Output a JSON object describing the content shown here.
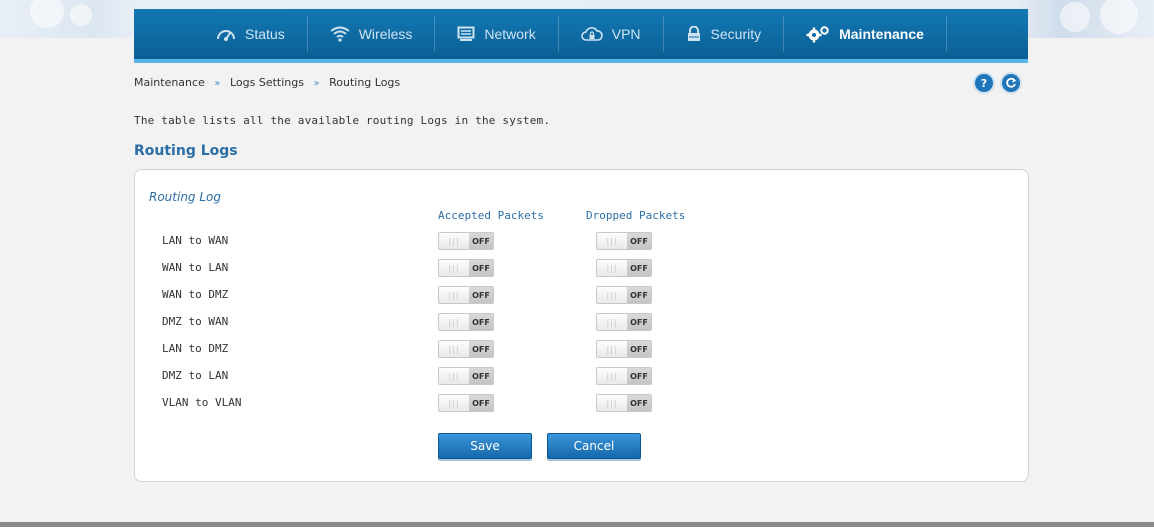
{
  "nav": {
    "items": [
      {
        "label": "Status",
        "icon": "dashboard-icon",
        "active": false
      },
      {
        "label": "Wireless",
        "icon": "wifi-icon",
        "active": false
      },
      {
        "label": "Network",
        "icon": "monitor-icon",
        "active": false
      },
      {
        "label": "VPN",
        "icon": "cloud-lock-icon",
        "active": false
      },
      {
        "label": "Security",
        "icon": "lock-icon",
        "active": false
      },
      {
        "label": "Maintenance",
        "icon": "gears-icon",
        "active": true
      }
    ],
    "colors": {
      "bar": "#0b6aa5",
      "accent": "#58b4e8"
    }
  },
  "breadcrumb": {
    "items": [
      "Maintenance",
      "Logs Settings",
      "Routing Logs"
    ],
    "separator": "»"
  },
  "help": {
    "help_symbol": "?",
    "refresh_icon": "refresh-icon"
  },
  "description": "The table lists all the available routing Logs in the system.",
  "section_title": "Routing Logs",
  "panel": {
    "title": "Routing Log",
    "headers": {
      "accepted": "Accepted Packets",
      "dropped": "Dropped Packets"
    },
    "rows": [
      {
        "label": "LAN to WAN",
        "accepted": "OFF",
        "dropped": "OFF"
      },
      {
        "label": "WAN to LAN",
        "accepted": "OFF",
        "dropped": "OFF"
      },
      {
        "label": "WAN to DMZ",
        "accepted": "OFF",
        "dropped": "OFF"
      },
      {
        "label": "DMZ to WAN",
        "accepted": "OFF",
        "dropped": "OFF"
      },
      {
        "label": "LAN to DMZ",
        "accepted": "OFF",
        "dropped": "OFF"
      },
      {
        "label": "DMZ to LAN",
        "accepted": "OFF",
        "dropped": "OFF"
      },
      {
        "label": "VLAN to VLAN",
        "accepted": "OFF",
        "dropped": "OFF"
      }
    ],
    "toggle_grip": "|||"
  },
  "buttons": {
    "save": "Save",
    "cancel": "Cancel"
  }
}
